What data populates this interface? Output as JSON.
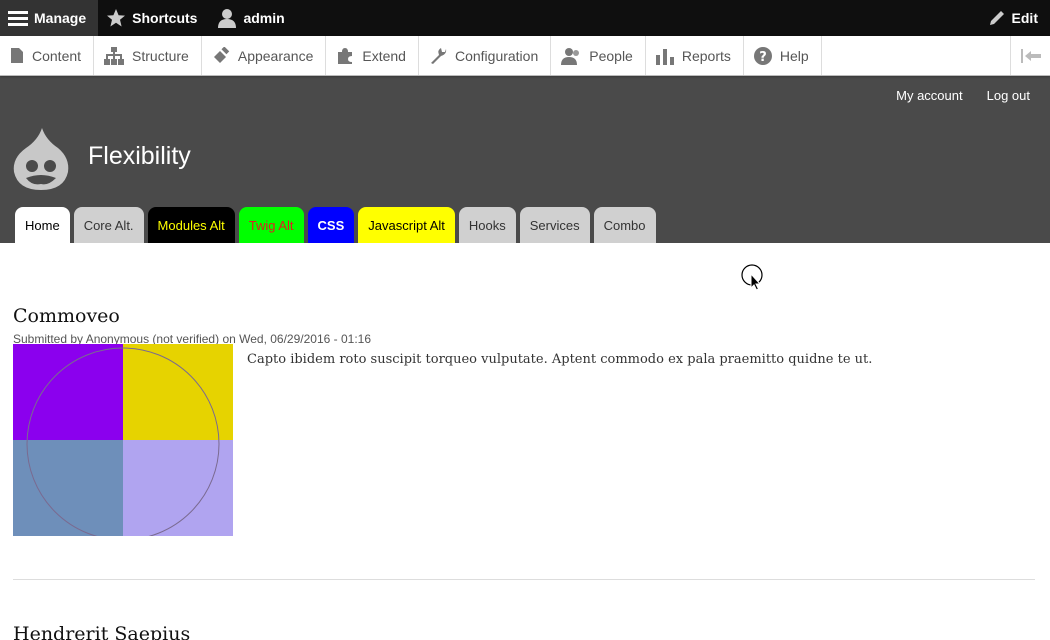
{
  "toolbar": {
    "manage": "Manage",
    "shortcuts": "Shortcuts",
    "user": "admin",
    "edit": "Edit"
  },
  "tray": {
    "items": [
      "Content",
      "Structure",
      "Appearance",
      "Extend",
      "Configuration",
      "People",
      "Reports",
      "Help"
    ]
  },
  "header": {
    "site_name": "Flexibility",
    "my_account": "My account",
    "log_out": "Log out"
  },
  "tabs": [
    "Home",
    "Core Alt.",
    "Modules Alt",
    "Twig Alt",
    "CSS",
    "Javascript Alt",
    "Hooks",
    "Services",
    "Combo"
  ],
  "articles": [
    {
      "title": "Commoveo",
      "meta": "Submitted by Anonymous (not verified) on Wed, 06/29/2016 - 01:16",
      "body": "Capto ibidem roto suscipit torqueo vulputate. Aptent commodo ex pala praemitto quidne te ut."
    },
    {
      "title": "Hendrerit Saepius"
    }
  ],
  "colors": {
    "toolbar_bg": "#0f0f0f",
    "header_bg": "#4a4a4a",
    "image_q1": "#8b00ee",
    "image_q2": "#e6d300",
    "image_q3": "#6e8fba",
    "image_q4": "#b0a4f0"
  }
}
